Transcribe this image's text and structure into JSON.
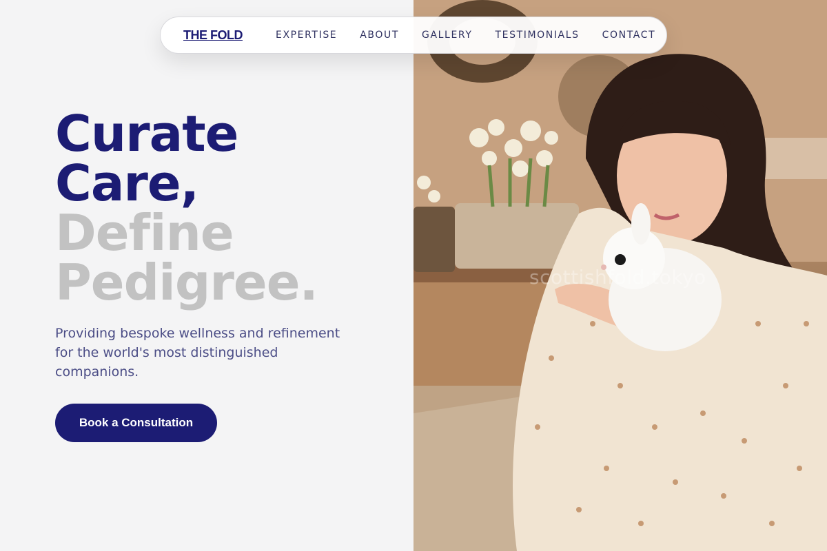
{
  "nav": {
    "brand": "THE FOLD",
    "links": [
      "EXPERTISE",
      "ABOUT",
      "GALLERY",
      "TESTIMONIALS",
      "CONTACT"
    ]
  },
  "hero": {
    "headline_dark": [
      "Curate",
      "Care,"
    ],
    "headline_light": [
      "Define",
      "Pedigree."
    ],
    "subtext": "Providing bespoke wellness and refinement for the world's most distinguished companions.",
    "cta_label": "Book a Consultation"
  },
  "photo": {
    "watermark": "scottishfold.tokyo"
  },
  "colors": {
    "brand_navy": "#1c1c74",
    "headline_muted": "#c2c2c2",
    "background": "#f4f4f5"
  }
}
